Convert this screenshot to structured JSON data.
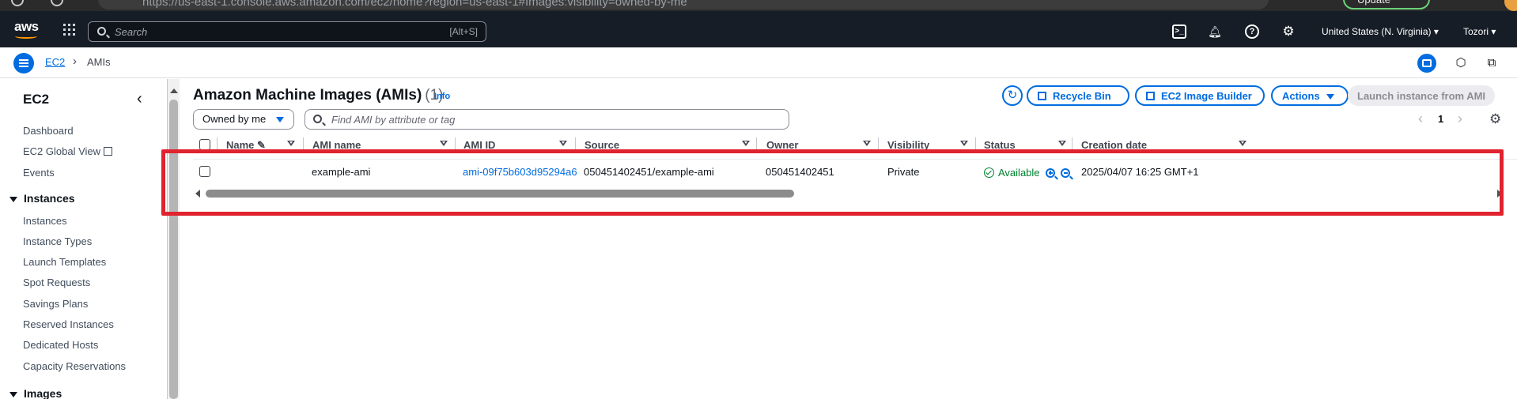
{
  "browser": {
    "url": "https://us-east-1.console.aws.amazon.com/ec2/home?region=us-east-1#Images:visibility=owned-by-me",
    "update_label": "Update"
  },
  "topnav": {
    "logo": "aws",
    "search_placeholder": "Search",
    "search_shortcut": "[Alt+S]",
    "region": "United States (N. Virginia) ▾",
    "user": "Tozori ▾"
  },
  "breadcrumb": {
    "root": "EC2",
    "separator": "›",
    "current": "AMIs"
  },
  "sidebar": {
    "title": "EC2",
    "top_links": [
      "Dashboard",
      "EC2 Global View",
      "Events"
    ],
    "sections": [
      {
        "label": "Instances",
        "items": [
          "Instances",
          "Instance Types",
          "Launch Templates",
          "Spot Requests",
          "Savings Plans",
          "Reserved Instances",
          "Dedicated Hosts",
          "Capacity Reservations"
        ]
      },
      {
        "label": "Images",
        "items": []
      }
    ]
  },
  "main": {
    "title": "Amazon Machine Images (AMIs)",
    "count": "(1)",
    "info": "Info",
    "buttons": {
      "recycle_bin": "Recycle Bin",
      "image_builder": "EC2 Image Builder",
      "actions": "Actions",
      "launch": "Launch instance from AMI"
    },
    "owner_filter": "Owned by me",
    "search_placeholder": "Find AMI by attribute or tag",
    "pagination": {
      "current_page": "1"
    },
    "columns": [
      "Name",
      "AMI name",
      "AMI ID",
      "Source",
      "Owner",
      "Visibility",
      "Status",
      "Creation date"
    ],
    "rows": [
      {
        "name": "",
        "ami_name": "example-ami",
        "ami_id": "ami-09f75b603d95294a6",
        "source": "050451402451/example-ami",
        "owner": "050451402451",
        "visibility": "Private",
        "status": "Available",
        "creation_date": "2025/04/07 16:25 GMT+1"
      }
    ]
  },
  "colors": {
    "accent": "#006ce0",
    "topnav_bg": "#161d26",
    "status_ok": "#00802f",
    "highlight": "#e0232e"
  },
  "icons": [
    "grid-icon",
    "search-icon",
    "cloudshell-icon",
    "bell-icon",
    "help-icon",
    "gear-icon",
    "menu-icon",
    "refresh-icon",
    "external-link-icon",
    "pencil-icon",
    "sort-icon",
    "check-circle-icon",
    "zoom-in-icon",
    "zoom-out-icon",
    "chevron-left-icon",
    "chevron-right-icon"
  ]
}
